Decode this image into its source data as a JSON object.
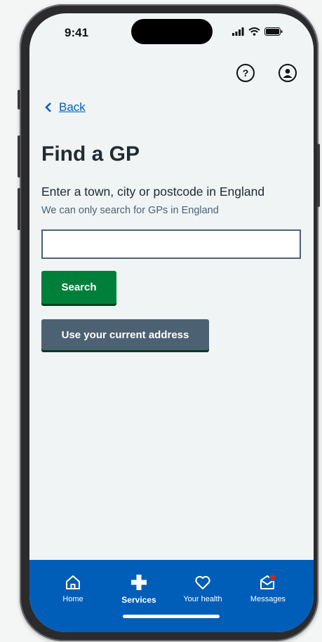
{
  "status": {
    "time": "9:41"
  },
  "nav": {
    "back_label": "Back"
  },
  "page": {
    "title": "Find a GP",
    "field_label": "Enter a town, city or postcode in England",
    "hint": "We can only search for GPs in England",
    "search_value": ""
  },
  "buttons": {
    "search": "Search",
    "current_address": "Use your current address"
  },
  "tabs": [
    {
      "label": "Home",
      "icon": "home-icon",
      "active": false
    },
    {
      "label": "Services",
      "icon": "plus-icon",
      "active": true
    },
    {
      "label": "Your health",
      "icon": "heart-icon",
      "active": false
    },
    {
      "label": "Messages",
      "icon": "envelope-icon",
      "active": false,
      "has_notification": true
    }
  ],
  "colors": {
    "brand_blue": "#005eb8",
    "primary_green": "#007f3b",
    "secondary_grey": "#4c6272",
    "notification_red": "#d5281b"
  }
}
